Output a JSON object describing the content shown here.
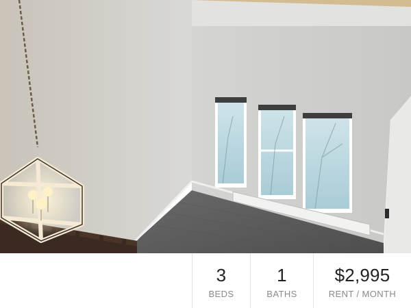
{
  "listing_photo": {
    "icon": "room-photo",
    "description_hidden": true
  },
  "stats": [
    {
      "value": "3",
      "label": "BEDS"
    },
    {
      "value": "1",
      "label": "BATHS"
    },
    {
      "value": "$2,995",
      "label": "RENT / MONTH"
    }
  ],
  "colors": {
    "wall": "#c9c9c6",
    "floor": "#5e5e5e",
    "value_text": "#222222",
    "label_text": "#8a8a8a",
    "divider": "#e3e3e3"
  }
}
